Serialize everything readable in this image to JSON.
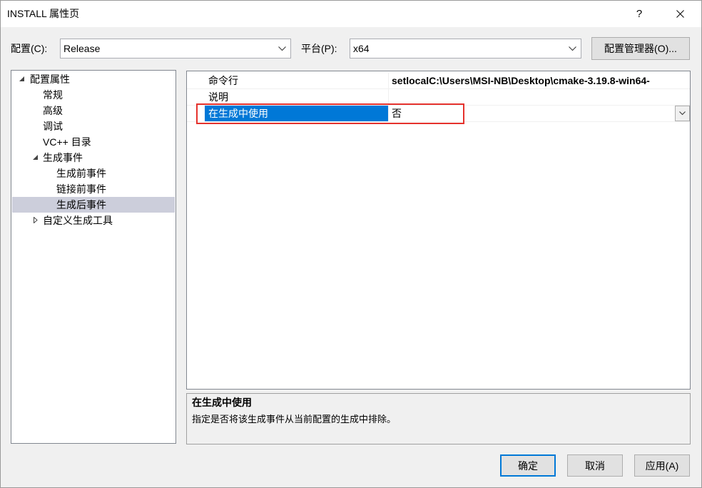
{
  "window": {
    "title": "INSTALL 属性页",
    "help_label": "?",
    "close_icon": "close-icon"
  },
  "config_bar": {
    "config_label": "配置(C):",
    "config_value": "Release",
    "platform_label": "平台(P):",
    "platform_value": "x64",
    "dropdown_icon": "chevron-down-icon",
    "manager_button_label": "配置管理器(O)..."
  },
  "tree": {
    "items": [
      {
        "label": "配置属性",
        "icon": "expanded-arrow-icon",
        "children": [
          {
            "label": "常规"
          },
          {
            "label": "高级"
          },
          {
            "label": "调试"
          },
          {
            "label": "VC++ 目录"
          },
          {
            "label": "生成事件",
            "icon": "expanded-arrow-icon",
            "children": [
              {
                "label": "生成前事件"
              },
              {
                "label": "链接前事件"
              },
              {
                "label": "生成后事件",
                "selected": true
              }
            ]
          },
          {
            "label": "自定义生成工具",
            "icon": "collapsed-arrow-icon"
          }
        ]
      }
    ]
  },
  "grid": {
    "rows": [
      {
        "name": "命令行",
        "value": "setlocalC:\\Users\\MSI-NB\\Desktop\\cmake-3.19.8-win64-"
      },
      {
        "name": "说明",
        "value": ""
      },
      {
        "name": "在生成中使用",
        "value": "否",
        "selected": true
      }
    ]
  },
  "description": {
    "title": "在生成中使用",
    "text": "指定是否将该生成事件从当前配置的生成中排除。"
  },
  "buttons": {
    "ok_label": "确定",
    "cancel_label": "取消",
    "apply_label": "应用(A)"
  },
  "colors": {
    "selection": "#0078D7",
    "tree_selection": "#CCCEDB",
    "default_button_border": "#0078D7",
    "annotation": "#E5322D"
  }
}
